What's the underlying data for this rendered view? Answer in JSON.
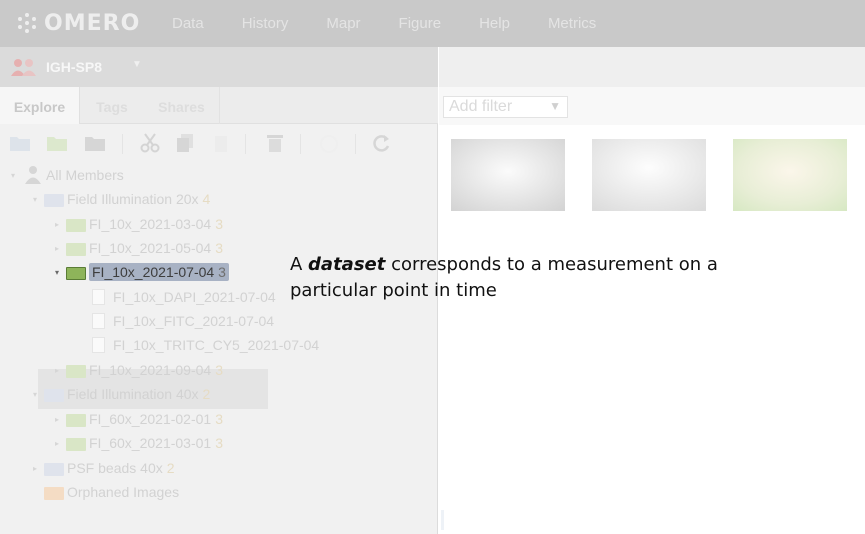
{
  "app": {
    "logo_text": "OMERO",
    "nav": [
      "Data",
      "History",
      "Mapr",
      "Figure",
      "Help",
      "Metrics"
    ]
  },
  "group": {
    "name": "IGH-SP8",
    "caret": "▼"
  },
  "tabs": [
    {
      "label": "Explore",
      "active": true
    },
    {
      "label": "Tags",
      "active": false
    },
    {
      "label": "Shares",
      "active": false
    }
  ],
  "toolbar_icons": [
    "new-project-icon",
    "new-dataset-icon",
    "new-screen-icon",
    "cut-icon",
    "copy-icon",
    "paste-icon",
    "delete-icon",
    "link-icon",
    "refresh-icon"
  ],
  "tree": {
    "root": {
      "label": "All Members"
    },
    "projects": [
      {
        "label": "Field Illumination 20x",
        "count": "4",
        "datasets": [
          {
            "label": "FI_10x_2021-03-04",
            "count": "3"
          },
          {
            "label": "FI_10x_2021-05-04",
            "count": "3"
          },
          {
            "label": "FI_10x_2021-07-04",
            "count": "3",
            "selected": true,
            "images": [
              "FI_10x_DAPI_2021-07-04",
              "FI_10x_FITC_2021-07-04",
              "FI_10x_TRITC_CY5_2021-07-04"
            ]
          },
          {
            "label": "FI_10x_2021-09-04",
            "count": "3"
          }
        ]
      },
      {
        "label": "Field Illumination 40x",
        "count": "2",
        "datasets": [
          {
            "label": "FI_60x_2021-02-01",
            "count": "3"
          },
          {
            "label": "FI_60x_2021-03-01",
            "count": "3"
          }
        ]
      },
      {
        "label": "PSF beads 40x",
        "count": "2"
      }
    ],
    "orphaned": {
      "label": "Orphaned Images"
    }
  },
  "right": {
    "filter": {
      "placeholder": "Add filter"
    },
    "thumbnails": [
      {
        "name": "thumbnail-dapi",
        "tint": "#d4d4d4"
      },
      {
        "name": "thumbnail-fitc",
        "tint": "#dedede"
      },
      {
        "name": "thumbnail-tritc",
        "tint": "#d8e6c0"
      }
    ]
  },
  "annotation": {
    "prefix": "A ",
    "emphasis": "dataset",
    "rest": " corresponds to a measurement on a particular point in time"
  },
  "colors": {
    "nav_bg": "#c9c9c9",
    "selected_folder": "#8eb45a",
    "selected_label_bg": "#a8b2c4",
    "count_text": "#e6dcc4"
  }
}
